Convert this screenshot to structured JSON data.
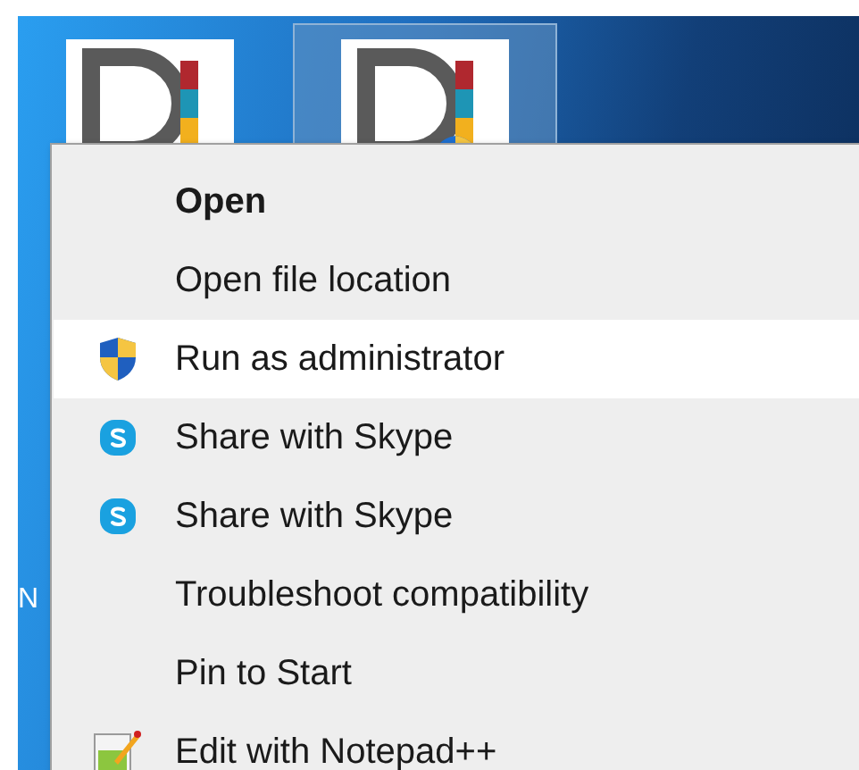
{
  "desktop": {
    "icons": [
      {
        "selected": false,
        "admin_badge": false
      },
      {
        "selected": true,
        "admin_badge": true
      }
    ],
    "covered_label": "N"
  },
  "context_menu": {
    "items": [
      {
        "label": "Open",
        "kind": "default",
        "selected": false
      },
      {
        "label": "Open file location",
        "kind": "plain",
        "selected": false
      },
      {
        "label": "Run as administrator",
        "kind": "shield",
        "selected": true
      },
      {
        "label": "Share with Skype",
        "kind": "skype",
        "selected": false
      },
      {
        "label": "Share with Skype",
        "kind": "skype",
        "selected": false
      },
      {
        "label": "Troubleshoot compatibility",
        "kind": "plain",
        "selected": false
      },
      {
        "label": "Pin to Start",
        "kind": "plain",
        "selected": false
      },
      {
        "label": "Edit with Notepad++",
        "kind": "notepad",
        "selected": false
      }
    ]
  }
}
